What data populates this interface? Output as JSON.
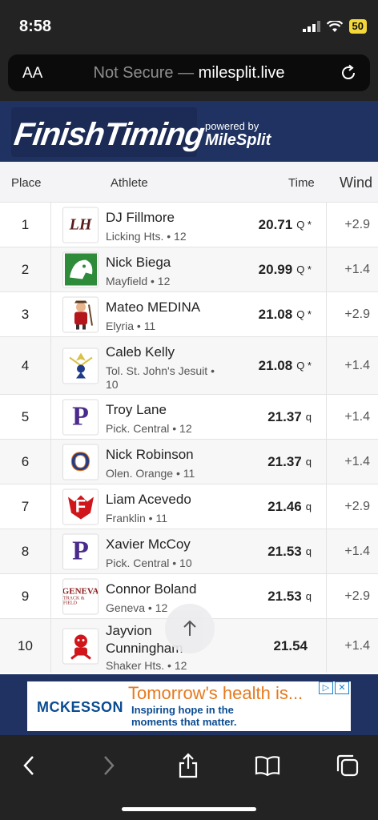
{
  "status": {
    "time": "8:58",
    "battery": "50"
  },
  "browser": {
    "aa_label": "AA",
    "url_prefix": "Not Secure —",
    "url_domain": "milesplit.live"
  },
  "brand": {
    "logo_text": "FinishTiming",
    "powered_by": "powered by",
    "partner": "MileSplit"
  },
  "table": {
    "headers": {
      "place": "Place",
      "athlete": "Athlete",
      "time": "Time",
      "wind": "Wind"
    },
    "rows": [
      {
        "place": "1",
        "name": "DJ Fillmore",
        "school": "Licking Hts. • 12",
        "time": "20.71",
        "qual": "Q *",
        "wind": "+2.9",
        "logo": "LH"
      },
      {
        "place": "2",
        "name": "Nick Biega",
        "school": "Mayfield • 12",
        "time": "20.99",
        "qual": "Q *",
        "wind": "+1.4",
        "logo": "wildcat"
      },
      {
        "place": "3",
        "name": "Mateo MEDINA",
        "school": "Elyria • 11",
        "time": "21.08",
        "qual": "Q *",
        "wind": "+2.9",
        "logo": "pioneer"
      },
      {
        "place": "4",
        "name": "Caleb Kelly",
        "school": "Tol. St. John's Jesuit • 10",
        "time": "21.08",
        "qual": "Q *",
        "wind": "+1.4",
        "logo": "titan"
      },
      {
        "place": "5",
        "name": "Troy Lane",
        "school": "Pick. Central • 12",
        "time": "21.37",
        "qual": "q",
        "wind": "+1.4",
        "logo": "P"
      },
      {
        "place": "6",
        "name": "Nick Robinson",
        "school": "Olen. Orange • 11",
        "time": "21.37",
        "qual": "q",
        "wind": "+1.4",
        "logo": "O"
      },
      {
        "place": "7",
        "name": "Liam Acevedo",
        "school": "Franklin • 11",
        "time": "21.46",
        "qual": "q",
        "wind": "+2.9",
        "logo": "F"
      },
      {
        "place": "8",
        "name": "Xavier McCoy",
        "school": "Pick. Central • 10",
        "time": "21.53",
        "qual": "q",
        "wind": "+1.4",
        "logo": "P"
      },
      {
        "place": "9",
        "name": "Connor Boland",
        "school": "Geneva • 12",
        "time": "21.53",
        "qual": "q",
        "wind": "+2.9",
        "logo_line1": "GENEVA",
        "logo_line2": "TRACK & FIELD"
      },
      {
        "place": "10",
        "name": "Jayvion Cunningham",
        "school": "Shaker Hts. • 12",
        "time": "21.54",
        "qual": "",
        "wind": "+1.4",
        "logo": "raider"
      }
    ]
  },
  "ad": {
    "brand": "MCKESSON",
    "headline": "Tomorrow's health is...",
    "subtext": "Inspiring hope in the moments that matter."
  },
  "icons": {
    "back": "chevron-left-icon",
    "forward": "chevron-right-icon",
    "share": "share-icon",
    "bookmarks": "book-icon",
    "tabs": "tabs-icon",
    "scroll_top": "arrow-up-icon"
  },
  "colors": {
    "brand_navy": "#1f3262",
    "ad_orange": "#e57a1f",
    "battery": "#f4d83a"
  }
}
